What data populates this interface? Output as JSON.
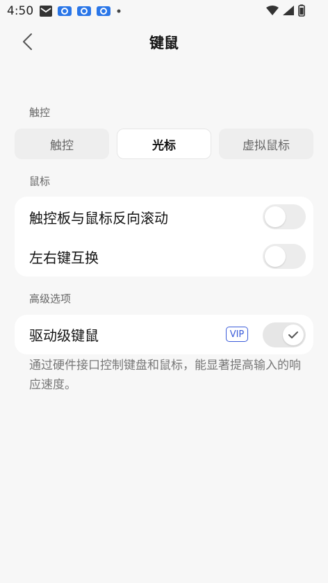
{
  "status_bar": {
    "time": "4:50",
    "icons": [
      "message-icon",
      "badge-icon",
      "badge-icon",
      "badge-icon",
      "dot-icon",
      "wifi-icon",
      "signal-icon",
      "battery-icon"
    ]
  },
  "header": {
    "title": "键鼠"
  },
  "touch_section": {
    "label": "触控",
    "segments": [
      {
        "label": "触控",
        "active": false
      },
      {
        "label": "光标",
        "active": true
      },
      {
        "label": "虚拟鼠标",
        "active": false
      }
    ]
  },
  "mouse_section": {
    "label": "鼠标",
    "rows": [
      {
        "label": "触控板与鼠标反向滚动",
        "on": false
      },
      {
        "label": "左右键互换",
        "on": false
      }
    ]
  },
  "advanced_section": {
    "label": "高级选项",
    "driver_label": "驱动级键鼠",
    "vip_badge": "VIP",
    "driver_on": true,
    "description": "通过硬件接口控制键盘和鼠标，能显著提高输入的响应速度。"
  },
  "colors": {
    "background": "#f7f7f7",
    "card": "#ffffff",
    "vip": "#3a5bd9"
  }
}
